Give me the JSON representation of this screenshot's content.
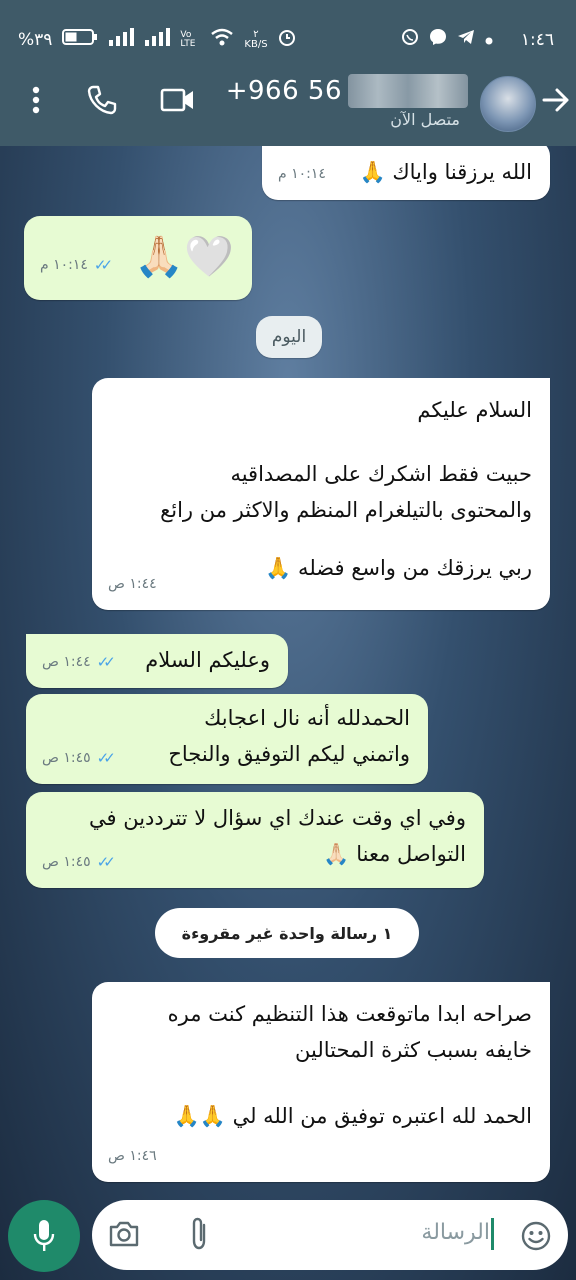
{
  "status_bar": {
    "time": "١:٤٦",
    "battery": "%٣٩",
    "network_speed_top": "٢",
    "network_speed_unit": "KB/S",
    "volte": "Vo LTE"
  },
  "header": {
    "contact_prefix": "+966 56",
    "contact_status": "متصل الآن"
  },
  "messages": [
    {
      "text": "الله يرزقنا واياك 🙏",
      "time": "١٠:١٤ م"
    },
    {
      "text": "🤍🙏🏻",
      "time": "١٠:١٤ م"
    },
    {
      "text": "السلام عليكم",
      "line2": "حبيت فقط اشكرك على المصداقيه",
      "line3": "والمحتوى بالتيلغرام المنظم والاكثر من رائع",
      "line4": "ربي يرزقك من واسع فضله 🙏",
      "time": "١:٤٤ ص"
    },
    {
      "text": "وعليكم السلام",
      "time": "١:٤٤ ص"
    },
    {
      "text": "الحمدلله أنه نال اعجابك",
      "line2": "واتمني ليكم التوفيق والنجاح",
      "time": "١:٤٥ ص"
    },
    {
      "text": "وفي اي وقت عندك اي سؤال لا تترددين في",
      "line2": "التواصل معنا 🙏🏻",
      "time": "١:٤٥ ص"
    },
    {
      "text": "صراحه ابدا ماتوقعت هذا التنظيم كنت مره",
      "line2": "خايفه بسبب كثرة المحتالين",
      "line3": "الحمد لله اعتبره توفيق من الله لي 🙏🙏",
      "time": "١:٤٦ ص"
    }
  ],
  "date_pill": "اليوم",
  "unread_pill": "١ رسالة واحدة غير مقروءة",
  "input": {
    "placeholder": "الرسالة"
  },
  "colors": {
    "header": "#3f5a68",
    "outgoing": "#e7fbd3",
    "incoming": "#ffffff",
    "accent": "#1f8a6a",
    "ticks": "#4aa3e8"
  },
  "icons": [
    "back-arrow-icon",
    "video-call-icon",
    "voice-call-icon",
    "more-vert-icon",
    "mic-icon",
    "camera-icon",
    "attach-icon",
    "emoji-icon"
  ]
}
